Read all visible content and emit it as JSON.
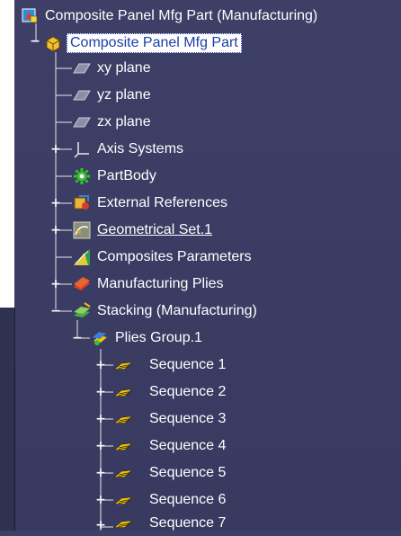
{
  "tree": {
    "root": {
      "label": "Composite Panel Mfg Part (Manufacturing)",
      "icon": "composite-document-icon"
    },
    "part": {
      "label": "Composite Panel Mfg Part",
      "icon": "part-icon",
      "selected": true
    },
    "items": [
      {
        "label": "xy plane",
        "icon": "plane-icon"
      },
      {
        "label": "yz plane",
        "icon": "plane-icon"
      },
      {
        "label": "zx plane",
        "icon": "plane-icon"
      },
      {
        "label": "Axis Systems",
        "icon": "axis-system-icon"
      },
      {
        "label": "PartBody",
        "icon": "gear-body-icon"
      },
      {
        "label": "External References",
        "icon": "external-references-icon"
      },
      {
        "label": "Geometrical Set.1",
        "icon": "geometrical-set-icon"
      },
      {
        "label": "Composites Parameters",
        "icon": "composites-parameters-icon"
      },
      {
        "label": "Manufacturing Plies",
        "icon": "manufacturing-plies-icon"
      },
      {
        "label": "Stacking (Manufacturing)",
        "icon": "stacking-icon"
      }
    ],
    "plies_group": {
      "label": "Plies Group.1",
      "icon": "plies-group-icon"
    },
    "sequences": [
      {
        "label": "Sequence 1",
        "icon": "sequence-icon"
      },
      {
        "label": "Sequence 2",
        "icon": "sequence-icon"
      },
      {
        "label": "Sequence 3",
        "icon": "sequence-icon"
      },
      {
        "label": "Sequence 4",
        "icon": "sequence-icon"
      },
      {
        "label": "Sequence 5",
        "icon": "sequence-icon"
      },
      {
        "label": "Sequence 6",
        "icon": "sequence-icon"
      },
      {
        "label": "Sequence 7",
        "icon": "sequence-icon"
      }
    ]
  },
  "colors": {
    "background": "#3d3f66",
    "text": "#ffffff",
    "selection_text": "#1c3fa8",
    "ply_yellow": "#f4c400"
  }
}
